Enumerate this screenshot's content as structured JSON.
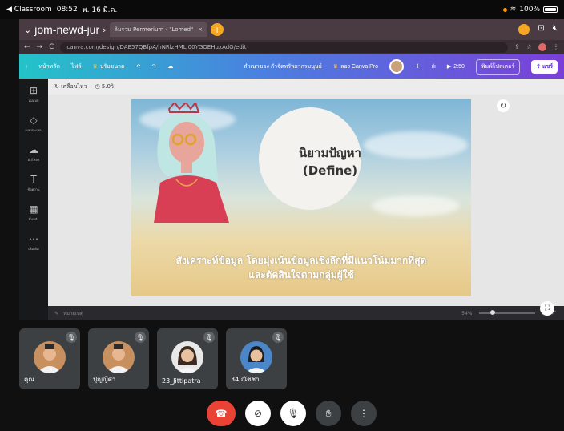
{
  "statusbar": {
    "app": "◀ Classroom",
    "time": "08:52",
    "date": "พ. 16 มี.ค.",
    "battery": "100%"
  },
  "browser": {
    "meet_name": "jom-newd-jur",
    "tabs": [
      "ลิ่มรวม Permerium - \"Lomed\"",
      ""
    ],
    "url": "canva.com/design/DAE57QBfpA/hNRlzHMLJ00YGOEHuxAdO/edit"
  },
  "canva": {
    "home": "หน้าหลัก",
    "file": "ไฟล์",
    "resize": "ปรับขนาด",
    "doc_title": "สำเนาของ กำจัดทรัพยากรมนุษย์",
    "try_pro": "ลอง Canva Pro",
    "play_time": "2:50",
    "print": "พิมพ์โปสเตอร์",
    "share": "แชร์",
    "sidebar": [
      {
        "icon": "template-icon",
        "label": "แม่แบบ"
      },
      {
        "icon": "elements-icon",
        "label": "องค์ประกอบ"
      },
      {
        "icon": "upload-icon",
        "label": "อัปโหลด"
      },
      {
        "icon": "text-icon",
        "label": "ข้อความ"
      },
      {
        "icon": "background-icon",
        "label": "พื้นหลัง"
      },
      {
        "icon": "more-icon",
        "label": "เพิ่มเติม"
      }
    ],
    "subtool": {
      "animate": "เคลื่อนไหว",
      "duration": "5.0วิ"
    },
    "slide": {
      "title_line1": "นิยามปัญหา",
      "title_line2": "(Define)",
      "body_line1": "สังเคราะห์ข้อมูล โดยมุ่งเน้นข้อมูลเชิงลึกที่มีแนวโน้มมากที่สุด",
      "body_line2": "และตัดสินใจตามกลุ่มผู้ใช้"
    },
    "notes": "หมายเหตุ",
    "zoom": "54%"
  },
  "participants": [
    {
      "name": "คุณ"
    },
    {
      "name": "ปุญญิศา"
    },
    {
      "name": "23_Jittipatra"
    },
    {
      "name": "34 ณัชชา"
    }
  ],
  "colors": {
    "end_call": "#ea4335",
    "canva_grad_start": "#23c3c8",
    "canva_grad_end": "#7b3fd8"
  }
}
